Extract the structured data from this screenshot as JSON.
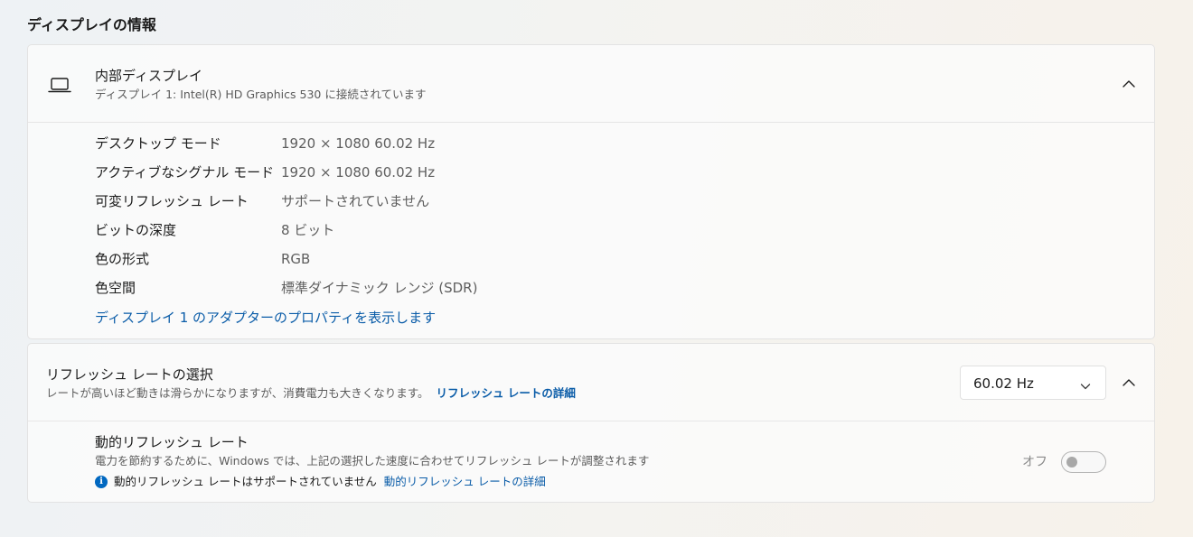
{
  "section": {
    "title": "ディスプレイの情報"
  },
  "internal_display": {
    "icon": "laptop-icon",
    "title": "内部ディスプレイ",
    "subtitle": "ディスプレイ 1: Intel(R) HD Graphics 530 に接続されています",
    "expanded": true,
    "details": [
      {
        "label": "デスクトップ モード",
        "value": "1920 × 1080 60.02 Hz"
      },
      {
        "label": "アクティブなシグナル モード",
        "value": "1920 × 1080 60.02 Hz"
      },
      {
        "label": "可変リフレッシュ レート",
        "value": "サポートされていません"
      },
      {
        "label": "ビットの深度",
        "value": "8 ビット"
      },
      {
        "label": "色の形式",
        "value": "RGB"
      },
      {
        "label": "色空間",
        "value": "標準ダイナミック レンジ (SDR)"
      }
    ],
    "adapter_link": "ディスプレイ 1 のアダプターのプロパティを表示します"
  },
  "refresh_rate": {
    "title": "リフレッシュ レートの選択",
    "subtitle": "レートが高いほど動きは滑らかになりますが、消費電力も大きくなります。",
    "details_link": "リフレッシュ レートの詳細",
    "selected": "60.02 Hz",
    "expanded": true,
    "dynamic": {
      "title": "動的リフレッシュ レート",
      "subtitle": "電力を節約するために、Windows では、上記の選択した速度に合わせてリフレッシュ レートが調整されます",
      "info_text": "動的リフレッシュ レートはサポートされていません",
      "info_link": "動的リフレッシュ レートの詳細",
      "toggle_label": "オフ",
      "toggle_on": false
    }
  },
  "colors": {
    "accent": "#0067c0",
    "link": "#0a5ca8"
  }
}
